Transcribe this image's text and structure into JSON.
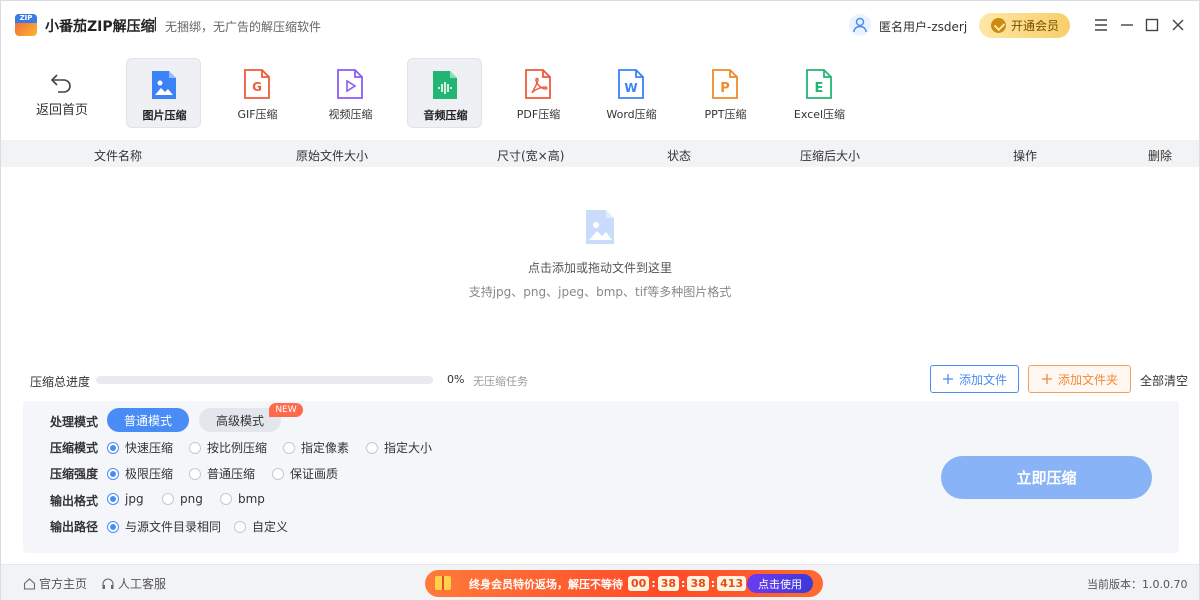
{
  "app": {
    "title": "小番茄ZIP解压缩",
    "separator": "|",
    "subtitle": "无捆绑，无广告的解压缩软件",
    "logo_text": "ZIP"
  },
  "user": {
    "name": "匿名用户-zsderj"
  },
  "vip": {
    "label": "开通会员"
  },
  "toolbar": {
    "back_label": "返回首页",
    "tools": [
      {
        "label": "图片压缩",
        "icon": "image-file-icon",
        "color": "#3b82f6",
        "active": true
      },
      {
        "label": "GIF压缩",
        "icon": "gif-file-icon",
        "color": "#f05a3a",
        "active": false
      },
      {
        "label": "视频压缩",
        "icon": "video-file-icon",
        "color": "#8b5cf6",
        "active": false
      },
      {
        "label": "音频压缩",
        "icon": "audio-file-icon",
        "color": "#22b573",
        "active": true
      },
      {
        "label": "PDF压缩",
        "icon": "pdf-file-icon",
        "color": "#f05a3a",
        "active": false
      },
      {
        "label": "Word压缩",
        "icon": "word-file-icon",
        "color": "#3b82f6",
        "active": false
      },
      {
        "label": "PPT压缩",
        "icon": "ppt-file-icon",
        "color": "#f08a2a",
        "active": false
      },
      {
        "label": "Excel压缩",
        "icon": "excel-file-icon",
        "color": "#22b573",
        "active": false
      }
    ]
  },
  "table": {
    "headers": [
      "文件名称",
      "原始文件大小",
      "尺寸(宽×高)",
      "状态",
      "压缩后大小",
      "操作",
      "删除"
    ]
  },
  "dropzone": {
    "main_text": "点击添加或拖动文件到这里",
    "sub_text": "支持jpg、png、jpeg、bmp、tif等多种图片格式"
  },
  "progress": {
    "label": "压缩总进度",
    "percent_text": "0%",
    "value": 0,
    "status": "无压缩任务"
  },
  "actions": {
    "add_file": "添加文件",
    "add_folder": "添加文件夹",
    "clear_all": "全部清空"
  },
  "settings": {
    "mode": {
      "label": "处理模式",
      "normal": "普通模式",
      "advanced": "高级模式",
      "badge": "NEW"
    },
    "compress_mode": {
      "label": "压缩模式",
      "options": [
        "快速压缩",
        "按比例压缩",
        "指定像素",
        "指定大小"
      ],
      "selected": 0
    },
    "strength": {
      "label": "压缩强度",
      "options": [
        "极限压缩",
        "普通压缩",
        "保证画质"
      ],
      "selected": 0
    },
    "format": {
      "label": "输出格式",
      "options": [
        "jpg",
        "png",
        "bmp"
      ],
      "selected": 0
    },
    "path": {
      "label": "输出路径",
      "options": [
        "与源文件目录相同",
        "自定义"
      ],
      "selected": 0
    },
    "compress_button": "立即压缩"
  },
  "footer": {
    "home_link": "官方主页",
    "support_link": "人工客服",
    "promo_text": "终身会员特价返场，解压不等待",
    "countdown": [
      "00",
      "38",
      "38",
      "413"
    ],
    "promo_button": "点击使用",
    "version": "当前版本：1.0.0.70"
  },
  "colors": {
    "accent": "#4a8cf6",
    "compress_button": "#88b4f7",
    "folder_button": "#f08a3a",
    "promo": "#ff4a28"
  }
}
